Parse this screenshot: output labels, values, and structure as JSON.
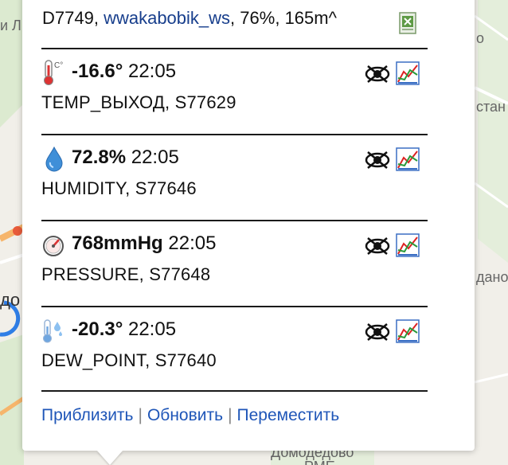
{
  "map": {
    "labels": {
      "left_top": "и Л",
      "right_1": "о",
      "right_2": "стан",
      "right_3": "дано",
      "left_city": "до",
      "bottom_1": "Домодедово",
      "bottom_2": "РМЕ"
    }
  },
  "station": {
    "id": "D7749",
    "name": "wwakabobik_ws",
    "battery": "76%",
    "signal": "165m^",
    "export_icon": "excel-icon"
  },
  "sensors": [
    {
      "icon": "thermometer-icon",
      "value": "-16.6°",
      "time": "22:05",
      "name": "TEMP_ВЫХОД, S77629"
    },
    {
      "icon": "water-drop-icon",
      "value": "72.8%",
      "time": "22:05",
      "name": "HUMIDITY, S77646"
    },
    {
      "icon": "gauge-icon",
      "value": "768mmHg",
      "time": "22:05",
      "name": "PRESSURE, S77648"
    },
    {
      "icon": "dew-point-icon",
      "value": "-20.3°",
      "time": "22:05",
      "name": "DEW_POINT, S77640"
    }
  ],
  "footer": {
    "zoom": "Приблизить",
    "refresh": "Обновить",
    "move": "Переместить",
    "separator": "|"
  }
}
